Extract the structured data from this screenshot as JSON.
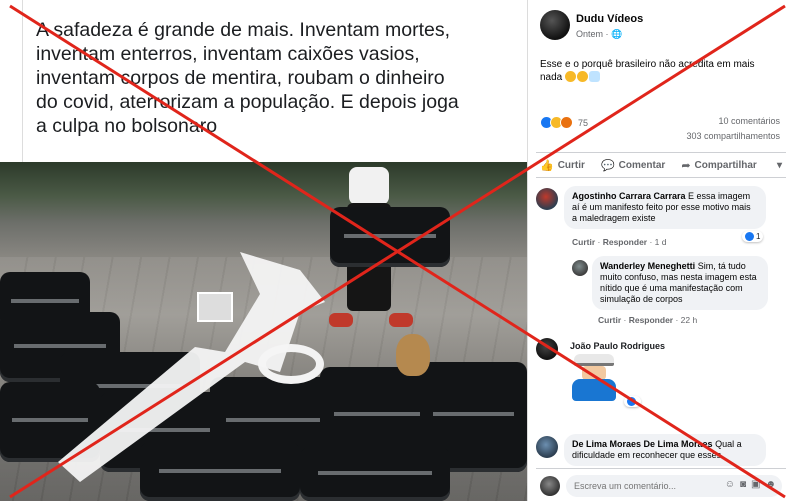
{
  "post_text": {
    "line1": "A safadeza é grande de mais. Inventam mortes,",
    "line2": "inventam enterros, inventam caixões vasios,",
    "line3": "inventam corpos de mentira, roubam o dinheiro",
    "line4": "do covid, aterrorizam a população. E depois joga",
    "line5": "a culpa no bolsonaro"
  },
  "post": {
    "author": "Dudu Vídeos",
    "time": "Ontem · ",
    "privacy_icon": "globe-icon",
    "body": "Esse e o porquê brasileiro não acredita em mais nada ",
    "reaction_count": "75",
    "comments_count": "10 comentários",
    "shares_count": "303 compartilhamentos"
  },
  "actions": {
    "like": "Curtir",
    "comment": "Comentar",
    "share": "Compartilhar"
  },
  "comments": [
    {
      "name": "Agostinho Carrara Carrara",
      "text": " E essa imagem aí é um manifesto feito por esse motivo mais a maledragem existe",
      "like": "Curtir",
      "reply": "Responder",
      "time": "1 d",
      "reacts": "1"
    },
    {
      "name": "Wanderley Meneghetti",
      "text": " Sim, tá tudo muito confuso, mas nesta imagem esta nítido que é uma manifestação com simulação de corpos",
      "like": "Curtir",
      "reply": "Responder",
      "time": "22 h"
    },
    {
      "name": "João Paulo Rodrigues"
    },
    {
      "name": "De Lima Moraes De Lima Moraes",
      "text": " Qual a dificuldade em reconhecer que esses"
    }
  ],
  "compose": {
    "placeholder": "Escreva um comentário..."
  }
}
